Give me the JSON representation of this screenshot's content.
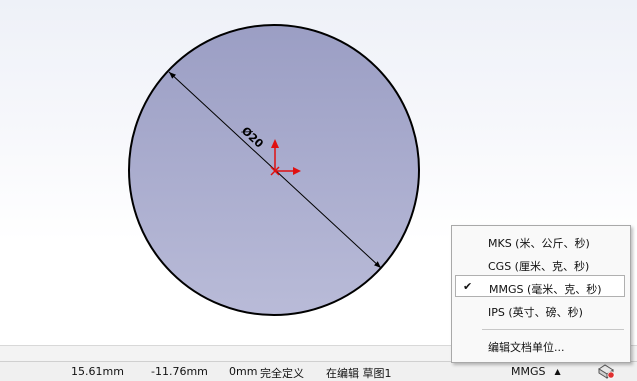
{
  "sketch": {
    "dimension_text": "Ø20",
    "circle_fill": "#aeb0d0",
    "circle_stroke": "#000000",
    "origin_color": "#e01010"
  },
  "status_bar": {
    "x_coord": "15.61mm",
    "y_coord": "-11.76mm",
    "z_coord": "0mm",
    "sketch_state": "完全定义",
    "edit_state": "在编辑 草图1",
    "unit_system": "MMGS"
  },
  "units_menu": {
    "items": [
      {
        "label": "MKS (米、公斤、秒)",
        "checked": false
      },
      {
        "label": "CGS (厘米、克、秒)",
        "checked": false
      },
      {
        "label": "MMGS (毫米、克、秒)",
        "checked": true
      },
      {
        "label": "IPS (英寸、磅、秒)",
        "checked": false
      }
    ],
    "edit_units_label": "编辑文档单位...",
    "check_glyph": "✔"
  }
}
